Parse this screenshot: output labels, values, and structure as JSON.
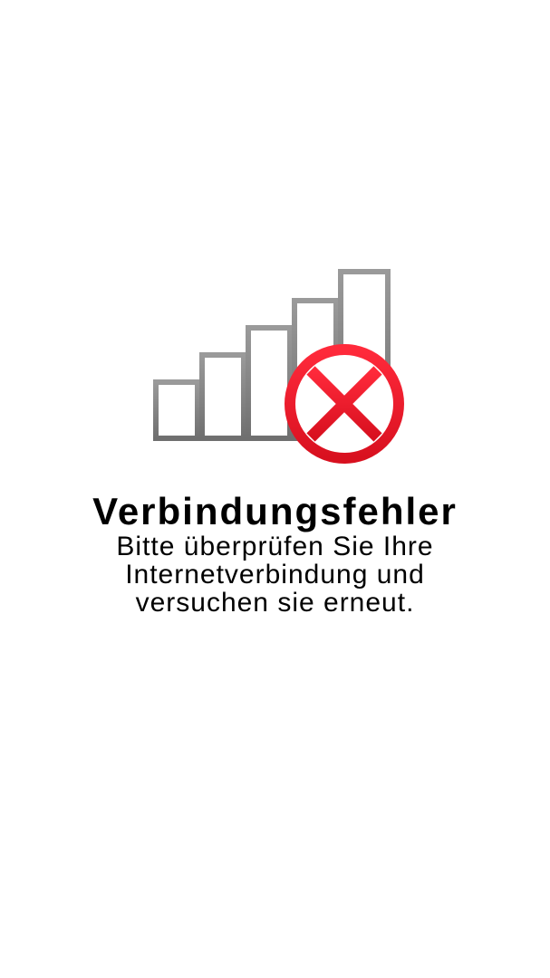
{
  "error": {
    "icon": "no-signal-error-icon",
    "title": "Verbindungsfehler",
    "message": "Bitte überprüfen Sie Ihre Internetverbindung und versuchen sie erneut."
  },
  "colors": {
    "background": "#ffffff",
    "text": "#000000",
    "bar_outline": "#8a8a8a",
    "error_red": "#e8192c"
  }
}
